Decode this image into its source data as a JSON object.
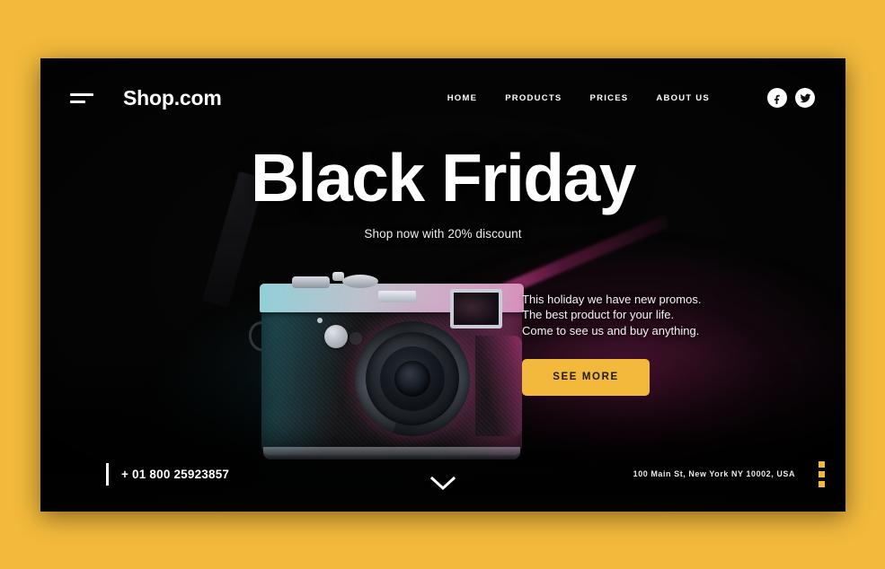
{
  "page": {
    "background_color": "#F2B93C",
    "card_background": "#050505",
    "accent_color": "#F2B93C"
  },
  "header": {
    "menu_icon": "hamburger-icon",
    "brand": "Shop.com",
    "nav": [
      {
        "label": "HOME"
      },
      {
        "label": "PRODUCTS"
      },
      {
        "label": "PRICES"
      },
      {
        "label": "ABOUT US"
      }
    ],
    "socials": [
      {
        "name": "facebook-icon",
        "title": "Facebook"
      },
      {
        "name": "twitter-icon",
        "title": "Twitter"
      }
    ]
  },
  "hero": {
    "title": "Black Friday",
    "subtitle": "Shop now with 20% discount",
    "image_alt": "vintage rangefinder camera with neon teal and magenta lighting"
  },
  "promo": {
    "line1": "This holiday we have new promos.",
    "line2": "The best product for your life.",
    "line3": "Come to see us and buy anything.",
    "cta_label": "SEE MORE"
  },
  "footer": {
    "phone": "+ 01 800 25923857",
    "address": "100 Main St, New York NY 10002, USA",
    "scroll_icon": "chevron-down-icon",
    "more_menu_icon": "vertical-dots-icon"
  }
}
